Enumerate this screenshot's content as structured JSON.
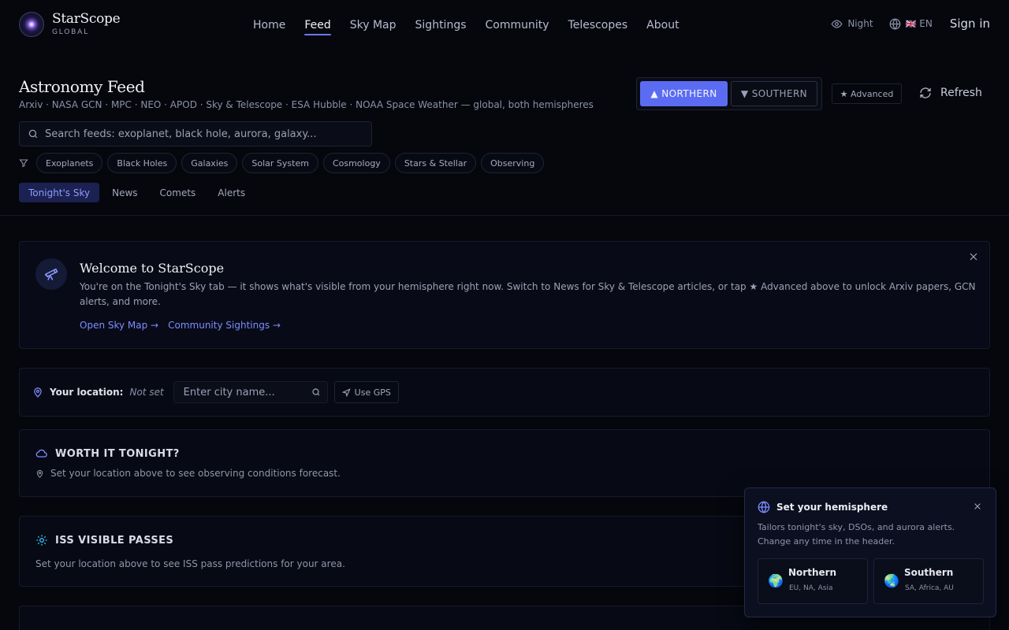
{
  "brand": {
    "name": "StarScope",
    "tagline": "GLOBAL"
  },
  "nav": {
    "items": [
      {
        "label": "Home",
        "active": false
      },
      {
        "label": "Feed",
        "active": true
      },
      {
        "label": "Sky Map",
        "active": false
      },
      {
        "label": "Sightings",
        "active": false
      },
      {
        "label": "Community",
        "active": false
      },
      {
        "label": "Telescopes",
        "active": false
      },
      {
        "label": "About",
        "active": false
      }
    ]
  },
  "header_right": {
    "night_label": "Night",
    "lang_flag": "🇬🇧",
    "lang_label": "EN",
    "signin_label": "Sign in"
  },
  "feed": {
    "title": "Astronomy Feed",
    "sources": "Arxiv · NASA GCN · MPC · NEO · APOD · Sky & Telescope · ESA Hubble · NOAA Space Weather — global, both hemispheres",
    "search_placeholder": "Search feeds: exoplanet, black hole, aurora, galaxy...",
    "filters": [
      "Exoplanets",
      "Black Holes",
      "Galaxies",
      "Solar System",
      "Cosmology",
      "Stars & Stellar",
      "Observing"
    ],
    "tabs": [
      {
        "label": "Tonight's Sky",
        "active": true
      },
      {
        "label": "News",
        "active": false
      },
      {
        "label": "Comets",
        "active": false
      },
      {
        "label": "Alerts",
        "active": false
      }
    ],
    "hemisphere": {
      "northern": "▲ NORTHERN",
      "southern": "▼ SOUTHERN",
      "selected": "northern"
    },
    "advanced_label": "★ Advanced",
    "refresh_label": "Refresh"
  },
  "welcome": {
    "title": "Welcome to StarScope",
    "body": "You're on the Tonight's Sky tab — it shows what's visible from your hemisphere right now. Switch to News for Sky & Telescope articles, or tap ★ Advanced above to unlock Arxiv papers, GCN alerts, and more.",
    "link_skymap": "Open Sky Map →",
    "link_community": "Community Sightings →"
  },
  "location": {
    "label": "Your location:",
    "value": "Not set",
    "input_placeholder": "Enter city name...",
    "gps_label": "Use GPS"
  },
  "worth_it": {
    "title": "WORTH IT TONIGHT?",
    "message": "Set your location above to see observing conditions forecast."
  },
  "iss": {
    "title": "ISS VISIBLE PASSES",
    "message": "Set your location above to see ISS pass predictions for your area."
  },
  "hemisphere_popup": {
    "title": "Set your hemisphere",
    "body": "Tailors tonight's sky, DSOs, and aurora alerts. Change any time in the header.",
    "northern": {
      "globe": "🌍",
      "name": "Northern",
      "regions": "EU, NA, Asia"
    },
    "southern": {
      "globe": "🌏",
      "name": "Southern",
      "regions": "SA, Africa, AU"
    }
  },
  "colors": {
    "accent": "#5b6cf2",
    "link": "#7c8cff",
    "background": "#05070d",
    "iss_icon": "#38bdf8"
  }
}
